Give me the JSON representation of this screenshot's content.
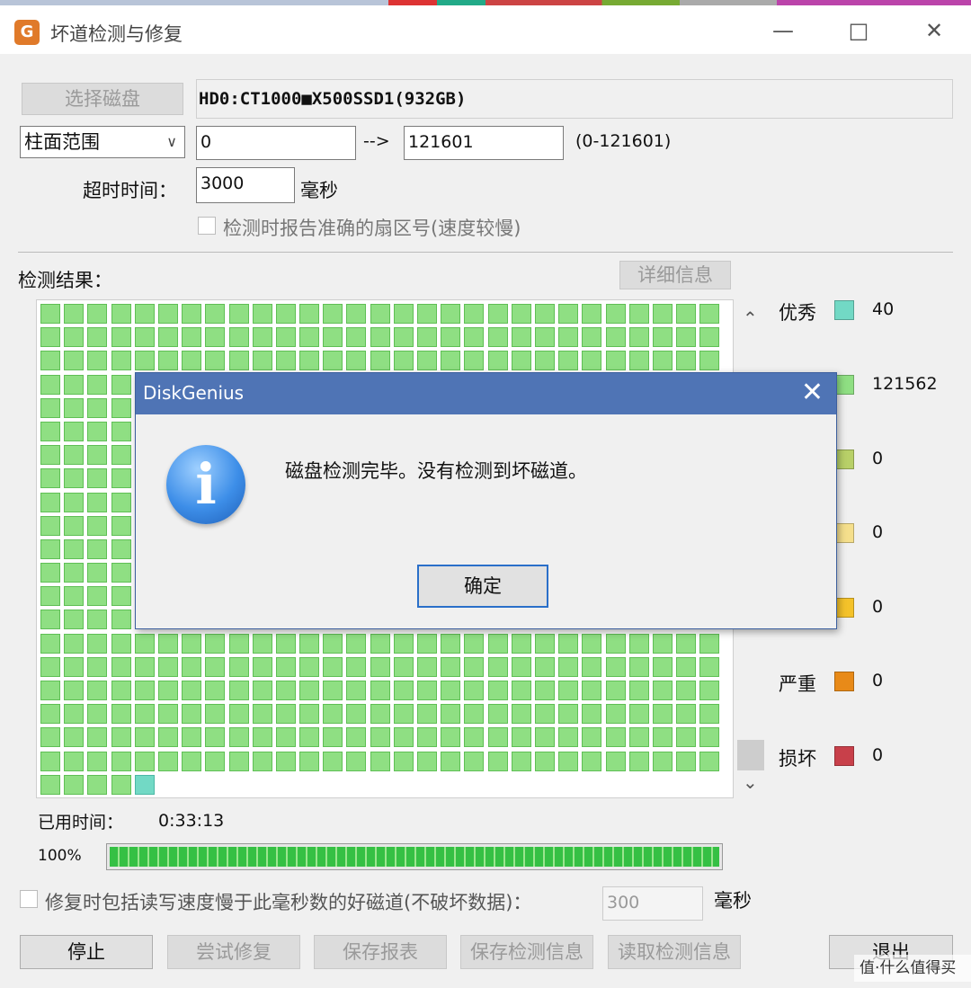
{
  "window": {
    "title": "坏道检测与修复",
    "minimize": "—",
    "maximize": "□",
    "close": "✕"
  },
  "disk": {
    "select_label": "选择磁盘",
    "info": "HD0:CT1000■X500SSD1(932GB)"
  },
  "range": {
    "mode": "柱面范围",
    "from": "0",
    "arrow": "-->",
    "to": "121601",
    "hint": "(0-121601)"
  },
  "timeout": {
    "label": "超时时间：",
    "value": "3000",
    "unit": "毫秒"
  },
  "accurate_sector": {
    "label": "检测时报告准确的扇区号(速度较慢)",
    "checked": false
  },
  "results": {
    "label": "检测结果：",
    "details_label": "详细信息"
  },
  "legend": [
    {
      "label": "优秀",
      "color": "#72d9c5",
      "count": "40"
    },
    {
      "label": "",
      "color": "#8fdf83",
      "count": "121562"
    },
    {
      "label": "",
      "color": "#b8d068",
      "count": "0"
    },
    {
      "label": "",
      "color": "#f5df8c",
      "count": "0"
    },
    {
      "label": "",
      "color": "#f4c22a",
      "count": "0"
    },
    {
      "label": "严重",
      "color": "#e88a18",
      "count": "0"
    },
    {
      "label": "损坏",
      "color": "#c8404a",
      "count": "0"
    }
  ],
  "elapsed": {
    "label": "已用时间：",
    "value": "0:33:13"
  },
  "progress": {
    "percent_label": "100%",
    "value": 1.0
  },
  "repair_option": {
    "label": "修复时包括读写速度慢于此毫秒数的好磁道(不破坏数据)：",
    "value": "300",
    "unit": "毫秒",
    "checked": false
  },
  "buttons": {
    "stop": "停止",
    "try_repair": "尝试修复",
    "save_report": "保存报表",
    "save_info": "保存检测信息",
    "load_info": "读取检测信息",
    "exit": "退出"
  },
  "dialog": {
    "title": "DiskGenius",
    "close": "✕",
    "message": "磁盘检测完毕。没有检测到坏磁道。",
    "ok_label": "确定",
    "icon": "info-icon"
  },
  "watermark": "值·什么值得买",
  "grid": {
    "rows_visible": 21,
    "cols": 29,
    "last_row_filled": 5,
    "excellent_index_last_row": 4
  }
}
